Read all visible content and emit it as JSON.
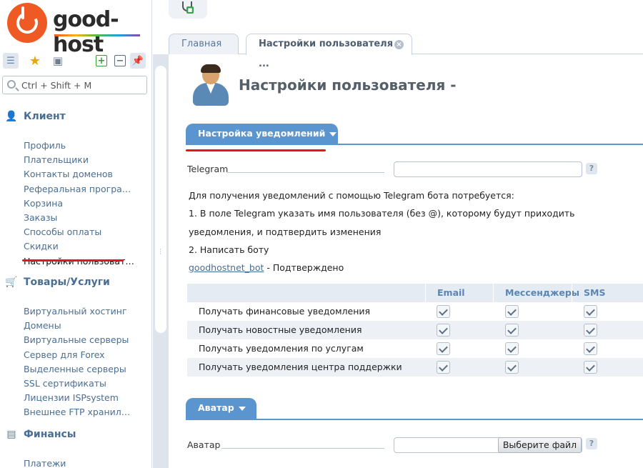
{
  "brand": {
    "name": "good-host"
  },
  "sidebar": {
    "search_placeholder": "Ctrl + Shift + M",
    "groups": [
      {
        "title": "Клиент",
        "icon": "user-icon",
        "items": [
          "Профиль",
          "Плательщики",
          "Контакты доменов",
          "Реферальная програ…",
          "Корзина",
          "Заказы",
          "Способы оплаты",
          "Скидки",
          "Настройки пользоват…"
        ]
      },
      {
        "title": "Товары/Услуги",
        "icon": "cart-icon",
        "items": [
          "Виртуальный хостинг",
          "Домены",
          "Виртуальные серверы",
          "Сервер для Forex",
          "Выделенные серверы",
          "SSL сертификаты",
          "Лицензии ISPsystem",
          "Внешнее FTP хранил…"
        ]
      },
      {
        "title": "Финансы",
        "icon": "cash-register-icon",
        "items": [
          "Платежи"
        ]
      }
    ],
    "active_item": "Настройки пользоват…"
  },
  "tabs": [
    {
      "label": "Главная",
      "active": false
    },
    {
      "label": "Настройки пользователя - ...",
      "active": true
    }
  ],
  "main": {
    "title": "Настройки пользователя -",
    "notify_section": {
      "title": "Настройка уведомлений",
      "telegram_label": "Telegram",
      "telegram_value": "",
      "help": "?",
      "info_lines": [
        "Для получения уведомлений с помощью Telegram бота потребуется:",
        "1. В поле Telegram указать имя пользователя (без @), которому будут приходить",
        "уведомления, и подтвердить изменения",
        "2. Написать боту"
      ],
      "bot_link": "goodhostnet_bot",
      "bot_status": " - Подтверждено",
      "table": {
        "columns": [
          "Email",
          "Мессенджеры",
          "SMS"
        ],
        "rows": [
          {
            "label": "Получать финансовые уведомления",
            "email": true,
            "messengers": true,
            "sms": true
          },
          {
            "label": "Получать новостные уведомления",
            "email": true,
            "messengers": true,
            "sms": true
          },
          {
            "label": "Получать уведомления по услугам",
            "email": true,
            "messengers": true,
            "sms": true
          },
          {
            "label": "Получать уведомления центра поддержки",
            "email": true,
            "messengers": true,
            "sms": true
          }
        ]
      }
    },
    "avatar_section": {
      "title": "Аватар",
      "avatar_label": "Аватар",
      "file_button": "Выберите файл",
      "help": "?"
    }
  },
  "colors": {
    "accent": "#5b95cf",
    "highlight": "#e8141a",
    "brand": "#ef5a24"
  }
}
